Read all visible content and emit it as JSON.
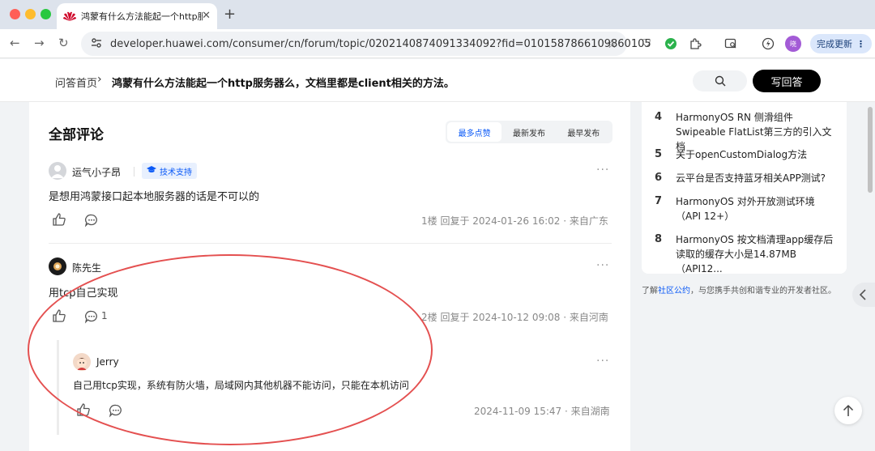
{
  "browser": {
    "tab_title": "鸿蒙有什么方法能起一个http服",
    "url": "developer.huawei.com/consumer/cn/forum/topic/0202140874091334092?fid=0101587866109860105",
    "profile_initials": "晓",
    "update_label": "完成更新",
    "colors": {
      "accent": "#0a59f7",
      "annotation": "#e45050"
    }
  },
  "header": {
    "home": "问答首页",
    "separator": "›",
    "question_title": "鸿蒙有什么方法能起一个http服务器么，文档里都是client相关的方法。",
    "answer_button": "写回答"
  },
  "comments": {
    "title": "全部评论",
    "sort_tabs": [
      "最多点赞",
      "最新发布",
      "最早发布"
    ],
    "items": [
      {
        "user": "运气小子昂",
        "badge": "技术支持",
        "text": "是想用鸿蒙接口起本地服务器的话是不可以的",
        "meta": "1楼   回复于 2024-01-26 16:02  ·  来自广东"
      },
      {
        "user": "陈先生",
        "text": "用tcp自己实现",
        "reply_count": "1",
        "meta": "2楼   回复于 2024-10-12 09:08  ·  来自河南"
      }
    ],
    "reply": {
      "user": "Jerry",
      "text": "自己用tcp实现，系统有防火墙，局域网内其他机器不能访问，只能在本机访问",
      "meta": "2024-11-09 15:47  ·  来自湖南"
    }
  },
  "sidebar": {
    "hot_list": [
      {
        "num": "4",
        "text": "HarmonyOS RN 侧滑组件Swipeable FlatList第三方的引入文档"
      },
      {
        "num": "5",
        "text": "关于openCustomDialog方法"
      },
      {
        "num": "6",
        "text": "云平台是否支持蓝牙相关APP测试?"
      },
      {
        "num": "7",
        "text": "HarmonyOS 对外开放测试环境（API 12+）"
      },
      {
        "num": "8",
        "text": "HarmonyOS 按文档清理app缓存后读取的缓存大小是14.87MB（API12..."
      }
    ],
    "note_prefix": "了解",
    "note_link": "社区公约",
    "note_suffix": "，与您携手共创和谐专业的开发者社区。"
  }
}
